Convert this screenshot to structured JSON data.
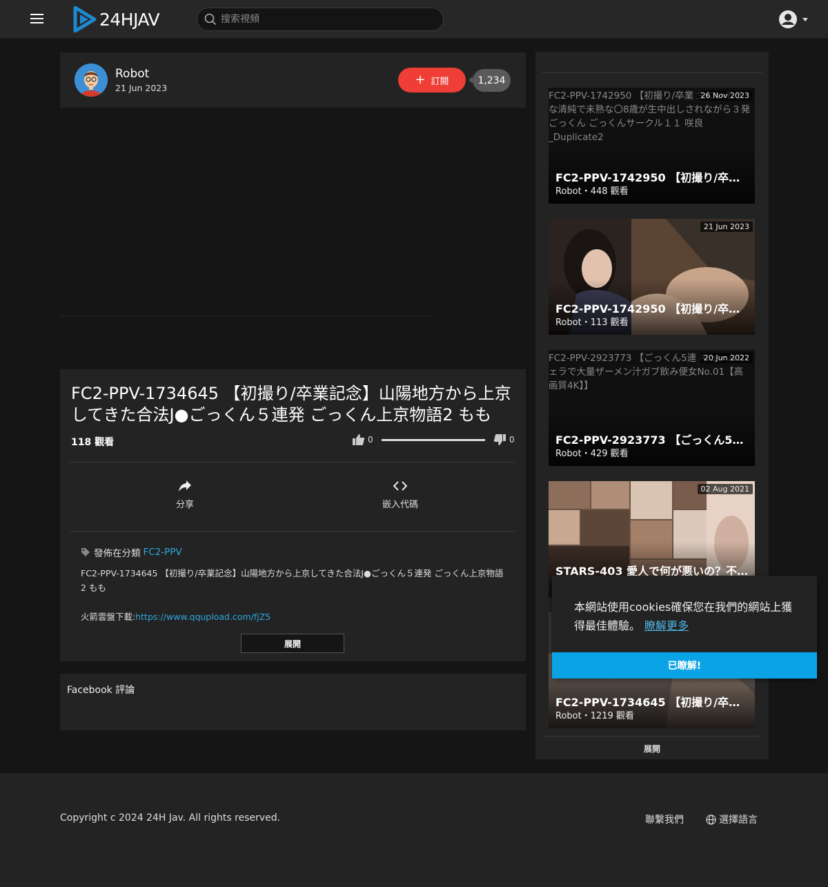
{
  "header": {
    "logo_text": "24HJAV",
    "search_placeholder": "搜索視頻"
  },
  "channel": {
    "name": "Robot",
    "date": "21 Jun 2023",
    "subscribe_label": "訂閱",
    "subscriber_count": "1,234"
  },
  "video": {
    "title": "FC2-PPV-1734645 【初撮り/卒業記念】山陽地方から上京してきた合法J●ごっくん５連発 ごっくん上京物語2 もも",
    "views": "118 觀看",
    "likes": "0",
    "dislikes": "0",
    "share_label": "分享",
    "embed_label": "嵌入代碼",
    "category_prefix": "發佈在分類",
    "category_link": "FC2-PPV",
    "description": "FC2-PPV-1734645 【初撮り/卒業記念】山陽地方から上京してきた合法J●ごっくん５連発 ごっくん上京物語2 もも",
    "download_prefix": "火箭雲盤下載:",
    "download_link": "https://www.qqupload.com/fjZ5",
    "expand_label": "展開"
  },
  "facebook": {
    "title": "Facebook 評論"
  },
  "sidebar": {
    "expand_label": "展開",
    "cards": [
      {
        "alt": "FC2-PPV-1742950 【初撮り/卒業 生にいそうな清純で未熟な〇8歳が生中出しされながら３発ごっくん ごっくんサークル１１ 咲良 _Duplicate2",
        "date": "26 Nov 2023",
        "title": "FC2-PPV-1742950 【初撮り/卒業...",
        "meta": "Robot・448 觀看"
      },
      {
        "alt": "",
        "date": "21 Jun 2023",
        "title": "FC2-PPV-1742950 【初撮り/卒業...",
        "meta": "Robot・113 觀看"
      },
      {
        "alt": "FC2-PPV-2923773 【ごっくん5連 キュームフェラで大量ザーメン汁ガブ飲み便女No.01【高画質4K】】",
        "date": "20 Jun 2022",
        "title": "FC2-PPV-2923773 【ごっくん5連...",
        "meta": "Robot・429 觀看"
      },
      {
        "alt": "",
        "date": "02 Aug 2021",
        "title": "STARS-403 愛人で何が悪いの？不...",
        "meta": ""
      },
      {
        "alt": "",
        "date": "",
        "title": "FC2-PPV-1734645 【初撮り/卒業...",
        "meta": "Robot・1219 觀看"
      }
    ]
  },
  "footer": {
    "copyright": "Copyright c 2024 24H Jav. All rights reserved.",
    "contact": "聯繫我們",
    "language": "選擇語言"
  },
  "cookie": {
    "text": "本網站使用cookies確保您在我們的網站上獲得最佳體驗。",
    "learn_more": "瞭解更多",
    "accept": "已瞭解!"
  },
  "colors": {
    "accent": "#ef3e35",
    "link": "#2fa6dd",
    "cookie_button": "#0aa4e6",
    "background": "#151515",
    "card": "#232323"
  }
}
